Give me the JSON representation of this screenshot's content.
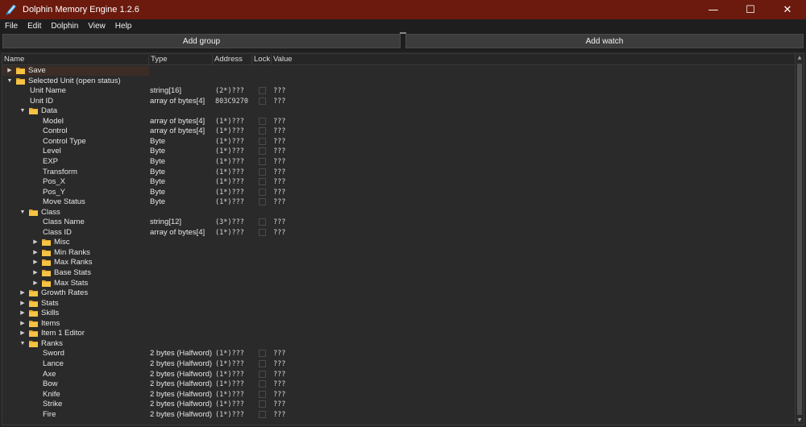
{
  "window": {
    "title": "Dolphin Memory Engine 1.2.6",
    "minimize": "—",
    "maximize": "☐",
    "close": "✕",
    "titlebar_color": "#6b1a0d"
  },
  "menu": [
    "File",
    "Edit",
    "Dolphin",
    "View",
    "Help"
  ],
  "buttons": {
    "add_group": "Add group",
    "add_watch": "Add watch"
  },
  "columns": {
    "name": "Name",
    "type": "Type",
    "address": "Address",
    "lock": "Lock",
    "value": "Value"
  },
  "rows": [
    {
      "level": 0,
      "expander": "collapsed",
      "folder": true,
      "name": "Save",
      "type": "",
      "address": "",
      "lock": false,
      "value": "",
      "selected": true
    },
    {
      "level": 0,
      "expander": "expanded",
      "folder": true,
      "name": "Selected Unit (open status)",
      "type": "",
      "address": "",
      "lock": false,
      "value": ""
    },
    {
      "level": 1,
      "expander": "none",
      "folder": false,
      "name": "Unit Name",
      "type": "string[16]",
      "address": "(2*)???",
      "lock": true,
      "value": "???"
    },
    {
      "level": 1,
      "expander": "none",
      "folder": false,
      "name": "Unit ID",
      "type": "array of bytes[4]",
      "address": "803C9270",
      "lock": true,
      "value": "???"
    },
    {
      "level": 1,
      "expander": "expanded",
      "folder": true,
      "name": "Data",
      "type": "",
      "address": "",
      "lock": false,
      "value": ""
    },
    {
      "level": 2,
      "expander": "none",
      "folder": false,
      "name": "Model",
      "type": "array of bytes[4]",
      "address": "(1*)???",
      "lock": true,
      "value": "???"
    },
    {
      "level": 2,
      "expander": "none",
      "folder": false,
      "name": "Control",
      "type": "array of bytes[4]",
      "address": "(1*)???",
      "lock": true,
      "value": "???"
    },
    {
      "level": 2,
      "expander": "none",
      "folder": false,
      "name": "Control Type",
      "type": "Byte",
      "address": "(1*)???",
      "lock": true,
      "value": "???"
    },
    {
      "level": 2,
      "expander": "none",
      "folder": false,
      "name": "Level",
      "type": "Byte",
      "address": "(1*)???",
      "lock": true,
      "value": "???"
    },
    {
      "level": 2,
      "expander": "none",
      "folder": false,
      "name": "EXP",
      "type": "Byte",
      "address": "(1*)???",
      "lock": true,
      "value": "???"
    },
    {
      "level": 2,
      "expander": "none",
      "folder": false,
      "name": "Transform",
      "type": "Byte",
      "address": "(1*)???",
      "lock": true,
      "value": "???"
    },
    {
      "level": 2,
      "expander": "none",
      "folder": false,
      "name": "Pos_X",
      "type": "Byte",
      "address": "(1*)???",
      "lock": true,
      "value": "???"
    },
    {
      "level": 2,
      "expander": "none",
      "folder": false,
      "name": "Pos_Y",
      "type": "Byte",
      "address": "(1*)???",
      "lock": true,
      "value": "???"
    },
    {
      "level": 2,
      "expander": "none",
      "folder": false,
      "name": "Move Status",
      "type": "Byte",
      "address": "(1*)???",
      "lock": true,
      "value": "???"
    },
    {
      "level": 1,
      "expander": "expanded",
      "folder": true,
      "name": "Class",
      "type": "",
      "address": "",
      "lock": false,
      "value": ""
    },
    {
      "level": 2,
      "expander": "none",
      "folder": false,
      "name": "Class Name",
      "type": "string[12]",
      "address": "(3*)???",
      "lock": true,
      "value": "???"
    },
    {
      "level": 2,
      "expander": "none",
      "folder": false,
      "name": "Class ID",
      "type": "array of bytes[4]",
      "address": "(1*)???",
      "lock": true,
      "value": "???"
    },
    {
      "level": 2,
      "expander": "collapsed",
      "folder": true,
      "name": "Misc",
      "type": "",
      "address": "",
      "lock": false,
      "value": ""
    },
    {
      "level": 2,
      "expander": "collapsed",
      "folder": true,
      "name": "Min Ranks",
      "type": "",
      "address": "",
      "lock": false,
      "value": ""
    },
    {
      "level": 2,
      "expander": "collapsed",
      "folder": true,
      "name": "Max Ranks",
      "type": "",
      "address": "",
      "lock": false,
      "value": ""
    },
    {
      "level": 2,
      "expander": "collapsed",
      "folder": true,
      "name": "Base Stats",
      "type": "",
      "address": "",
      "lock": false,
      "value": ""
    },
    {
      "level": 2,
      "expander": "collapsed",
      "folder": true,
      "name": "Max Stats",
      "type": "",
      "address": "",
      "lock": false,
      "value": ""
    },
    {
      "level": 1,
      "expander": "collapsed",
      "folder": true,
      "name": "Growth Rates",
      "type": "",
      "address": "",
      "lock": false,
      "value": ""
    },
    {
      "level": 1,
      "expander": "collapsed",
      "folder": true,
      "name": "Stats",
      "type": "",
      "address": "",
      "lock": false,
      "value": ""
    },
    {
      "level": 1,
      "expander": "collapsed",
      "folder": true,
      "name": "Skills",
      "type": "",
      "address": "",
      "lock": false,
      "value": ""
    },
    {
      "level": 1,
      "expander": "collapsed",
      "folder": true,
      "name": "Items",
      "type": "",
      "address": "",
      "lock": false,
      "value": ""
    },
    {
      "level": 1,
      "expander": "collapsed",
      "folder": true,
      "name": "Item 1 Editor",
      "type": "",
      "address": "",
      "lock": false,
      "value": ""
    },
    {
      "level": 1,
      "expander": "expanded",
      "folder": true,
      "name": "Ranks",
      "type": "",
      "address": "",
      "lock": false,
      "value": ""
    },
    {
      "level": 2,
      "expander": "none",
      "folder": false,
      "name": "Sword",
      "type": "2 bytes (Halfword)",
      "address": "(1*)???",
      "lock": true,
      "value": "???"
    },
    {
      "level": 2,
      "expander": "none",
      "folder": false,
      "name": "Lance",
      "type": "2 bytes (Halfword)",
      "address": "(1*)???",
      "lock": true,
      "value": "???"
    },
    {
      "level": 2,
      "expander": "none",
      "folder": false,
      "name": "Axe",
      "type": "2 bytes (Halfword)",
      "address": "(1*)???",
      "lock": true,
      "value": "???"
    },
    {
      "level": 2,
      "expander": "none",
      "folder": false,
      "name": "Bow",
      "type": "2 bytes (Halfword)",
      "address": "(1*)???",
      "lock": true,
      "value": "???"
    },
    {
      "level": 2,
      "expander": "none",
      "folder": false,
      "name": "Knife",
      "type": "2 bytes (Halfword)",
      "address": "(1*)???",
      "lock": true,
      "value": "???"
    },
    {
      "level": 2,
      "expander": "none",
      "folder": false,
      "name": "Strike",
      "type": "2 bytes (Halfword)",
      "address": "(1*)???",
      "lock": true,
      "value": "???"
    },
    {
      "level": 2,
      "expander": "none",
      "folder": false,
      "name": "Fire",
      "type": "2 bytes (Halfword)",
      "address": "(1*)???",
      "lock": true,
      "value": "???"
    }
  ]
}
